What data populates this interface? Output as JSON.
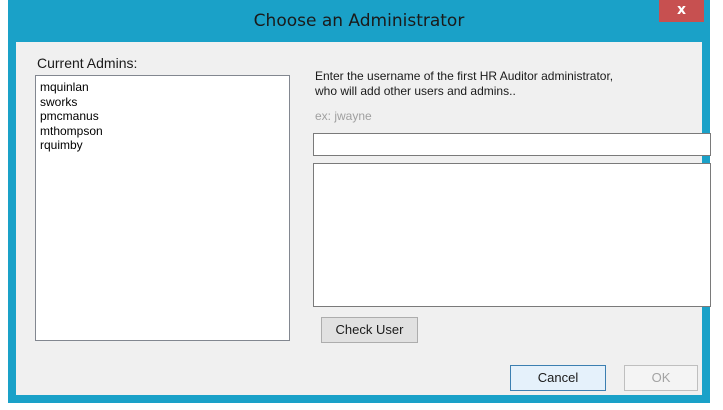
{
  "window": {
    "title": "Choose an Administrator",
    "close_glyph": "x",
    "accent_color": "#1aa1c8"
  },
  "admins": {
    "label": "Current Admins:",
    "items": [
      "mquinlan",
      "sworks",
      "pmcmanus",
      "mthompson",
      "rquimby"
    ]
  },
  "form": {
    "instructions_line1": "Enter the username of the first HR Auditor administrator,",
    "instructions_line2": "who will add other users and admins..",
    "example": "ex: jwayne",
    "username_value": ""
  },
  "buttons": {
    "check_user": "Check User",
    "cancel": "Cancel",
    "ok": "OK"
  }
}
